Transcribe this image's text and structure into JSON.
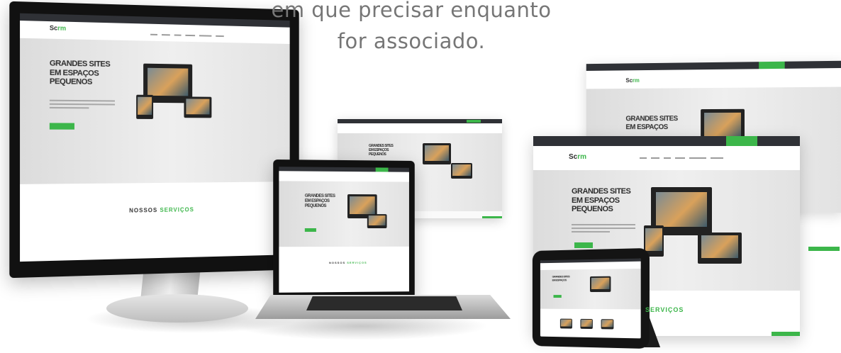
{
  "caption": {
    "line1": "em que precisar enquanto",
    "line2": "for associado."
  },
  "site": {
    "logo_prefix": "Sc",
    "logo_suffix": "rm",
    "hero_title_line1": "GRANDES SITES",
    "hero_title_line2": "EM ESPAÇOS",
    "hero_title_line3": "PEQUENOS",
    "section_title_a": "NOSSOS",
    "section_title_b": "SERVIÇOS"
  },
  "colors": {
    "accent": "#3cb64a",
    "topbar": "#2f3136",
    "caption": "#767676"
  }
}
